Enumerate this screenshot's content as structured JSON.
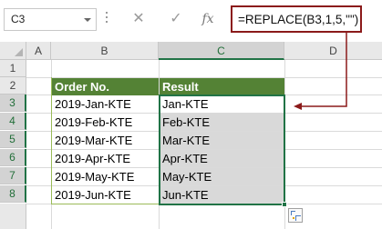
{
  "name_box": {
    "value": "C3"
  },
  "formula_bar": {
    "cancel_icon": "✕",
    "enter_icon": "✓",
    "fx_label": "fx",
    "formula": "=REPLACE(B3,1,5,\"\")"
  },
  "columns": [
    "A",
    "B",
    "C",
    "D"
  ],
  "rows": [
    "1",
    "2",
    "3",
    "4",
    "5",
    "6",
    "7",
    "8"
  ],
  "table": {
    "headers": {
      "order_no": "Order No.",
      "result": "Result"
    },
    "order_no": [
      "2019-Jan-KTE",
      "2019-Feb-KTE",
      "2019-Mar-KTE",
      "2019-Apr-KTE",
      "2019-May-KTE",
      "2019-Jun-KTE"
    ],
    "result": [
      "Jan-KTE",
      "Feb-KTE",
      "Mar-KTE",
      "Apr-KTE",
      "May-KTE",
      "Jun-KTE"
    ]
  },
  "colors": {
    "header_fill": "#548235",
    "selection": "#217346",
    "annotation_arrow": "#8b1a1a",
    "result_shading": "#d9d9d9"
  },
  "icons": {
    "quick_analysis": "quick-analysis-icon"
  }
}
